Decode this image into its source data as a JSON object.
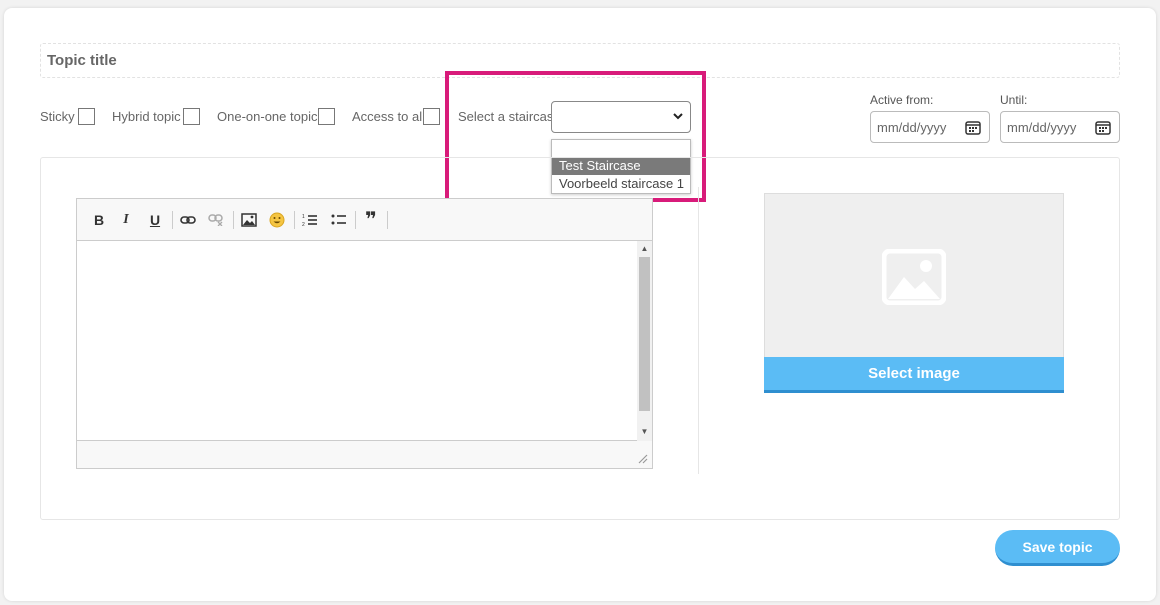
{
  "form": {
    "title_placeholder": "Topic title",
    "options": {
      "sticky": "Sticky",
      "hybrid": "Hybrid topic",
      "one_on_one": "One-on-one topic",
      "access_all": "Access to all"
    },
    "staircase": {
      "label": "Select a staircase",
      "selected_value": "",
      "options": [
        "",
        "Test Staircase",
        "Voorbeeld staircase 1"
      ],
      "highlighted_option": "Test Staircase"
    },
    "dates": {
      "active_from_label": "Active from:",
      "until_label": "Until:",
      "placeholder": "mm/dd/yyyy"
    }
  },
  "editor": {
    "toolbar_icons": [
      "bold-icon",
      "italic-icon",
      "underline-icon",
      "link-icon",
      "unlink-icon",
      "image-icon",
      "emoji-icon",
      "numbered-list-icon",
      "bullet-list-icon",
      "blockquote-icon"
    ],
    "bold": "B",
    "italic": "I",
    "underline": "U",
    "quote": "❞"
  },
  "image": {
    "select_label": "Select image"
  },
  "actions": {
    "save_label": "Save topic"
  },
  "colors": {
    "accent": "#5bbcf5",
    "highlight": "#d81b7a"
  }
}
